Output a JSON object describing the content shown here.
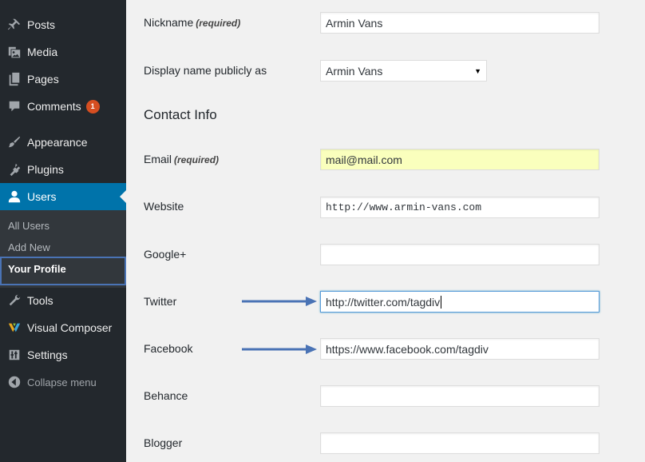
{
  "sidebar": {
    "items": [
      {
        "label": "Posts",
        "icon": "pin-icon"
      },
      {
        "label": "Media",
        "icon": "media-icon"
      },
      {
        "label": "Pages",
        "icon": "pages-icon"
      },
      {
        "label": "Comments",
        "icon": "comment-icon",
        "badge": "1"
      },
      {
        "label": "Appearance",
        "icon": "paintbrush-icon"
      },
      {
        "label": "Plugins",
        "icon": "plugin-icon"
      },
      {
        "label": "Users",
        "icon": "user-icon"
      },
      {
        "label": "Tools",
        "icon": "wrench-icon"
      },
      {
        "label": "Visual Composer",
        "icon": "visual-composer-icon"
      },
      {
        "label": "Settings",
        "icon": "settings-icon"
      }
    ],
    "submenu": [
      "All Users",
      "Add New",
      "Your Profile"
    ],
    "collapse_label": "Collapse menu",
    "accent_color": "#0073aa"
  },
  "form": {
    "nickname": {
      "label": "Nickname",
      "required": "(required)",
      "value": "Armin Vans"
    },
    "display_name": {
      "label": "Display name publicly as",
      "value": "Armin Vans"
    },
    "contact_title": "Contact Info",
    "email": {
      "label": "Email",
      "required": "(required)",
      "value": "mail@mail.com"
    },
    "website": {
      "label": "Website",
      "value": "http://www.armin-vans.com"
    },
    "google": {
      "label": "Google+",
      "value": ""
    },
    "twitter": {
      "label": "Twitter",
      "value": "http://twitter.com/tagdiv"
    },
    "facebook": {
      "label": "Facebook",
      "value": "https://www.facebook.com/tagdiv"
    },
    "behance": {
      "label": "Behance",
      "value": ""
    },
    "blogger": {
      "label": "Blogger",
      "value": ""
    }
  },
  "annotation_color": "#4a73b5"
}
